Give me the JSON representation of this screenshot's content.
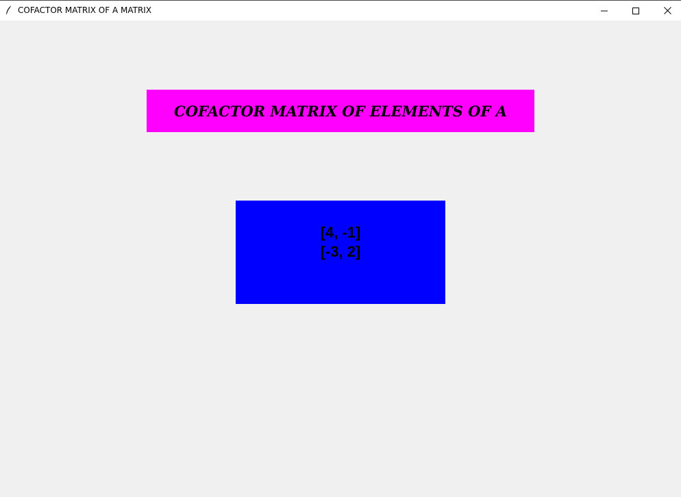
{
  "window": {
    "title": "COFACTOR MATRIX OF A MATRIX",
    "controls": {
      "minimize": "minimize-icon",
      "maximize": "maximize-icon",
      "close": "close-icon"
    },
    "icon": "feather-icon"
  },
  "header": {
    "text": "COFACTOR MATRIX OF ELEMENTS OF A",
    "background": "#ff00ff"
  },
  "matrix": {
    "background": "#0000ff",
    "rows": [
      "[4, -1]",
      "[-3, 2]"
    ]
  },
  "colors": {
    "window_bg": "#f0f0f0",
    "titlebar_bg": "#ffffff"
  }
}
